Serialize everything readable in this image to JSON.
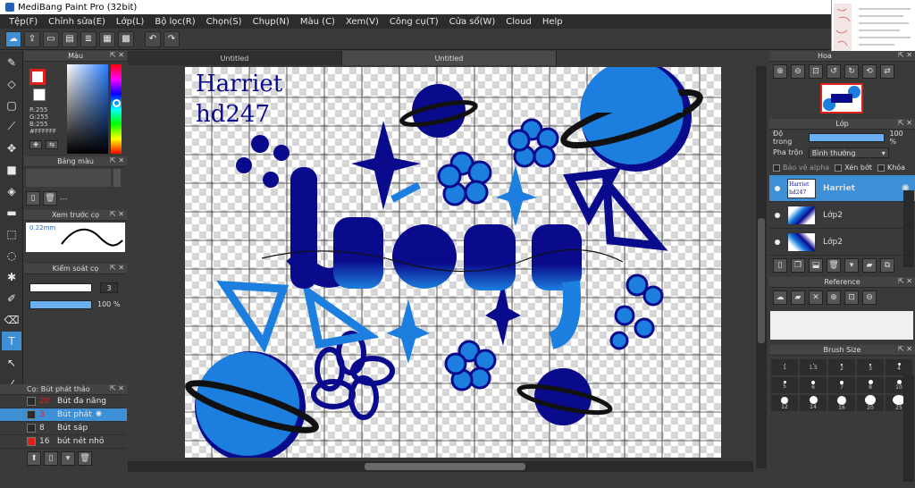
{
  "window": {
    "title": "MediBang Paint Pro (32bit)"
  },
  "menu": [
    "Tệp(F)",
    "Chỉnh sửa(E)",
    "Lớp(L)",
    "Bộ lọc(R)",
    "Chọn(S)",
    "Chụp(N)",
    "Màu (C)",
    "Xem(V)",
    "Công cụ(T)",
    "Cửa sổ(W)",
    "Cloud",
    "Help"
  ],
  "tabs": [
    "Untitled",
    "Untitled"
  ],
  "color_panel": {
    "title": "Màu",
    "r": "R:255",
    "g": "G:255",
    "b": "B:255",
    "hex": "#FFFFFF"
  },
  "palette_panel": {
    "title": "Bảng màu",
    "empty": "---"
  },
  "preview_panel": {
    "title": "Xem trước cọ",
    "size": "0.22mm"
  },
  "brush_control": {
    "title": "Kiểm soát cọ",
    "size_value": "3",
    "opacity_value": "100 %"
  },
  "brush_list": {
    "title": "Cọ: Bút phát thảo",
    "items": [
      {
        "num": "20",
        "name": "Bút đa năng"
      },
      {
        "num": "3",
        "name": "Bút phát"
      },
      {
        "num": "8",
        "name": "Bút sáp"
      },
      {
        "num": "16",
        "name": "bút nét nhỏ"
      }
    ]
  },
  "canvas": {
    "text_line1": "Harriet",
    "text_line2": "hd247"
  },
  "navigator": {
    "title": "Hoa"
  },
  "layer_panel": {
    "title": "Lớp",
    "opacity_label": "Độ trong",
    "opacity_value": "100 %",
    "blend_label": "Pha trộn",
    "blend_value": "Bình thường",
    "protect_alpha": "Bảo vệ alpha",
    "clipping": "Xén bớt",
    "lock": "Khóa",
    "layers": [
      "Harriet",
      "Lớp2",
      "Lớp2"
    ]
  },
  "reference_panel": {
    "title": "Reference"
  },
  "brush_size_panel": {
    "title": "Brush Size",
    "sizes": [
      "1",
      "1.5",
      "2",
      "3",
      "4",
      "5",
      "6",
      "7",
      "8",
      "10",
      "12",
      "14",
      "16",
      "20",
      "25"
    ]
  },
  "colors": {
    "accent": "#3d8fd6",
    "dark_blue": "#0a0a8c",
    "mid_blue": "#1464c8",
    "light_blue": "#2d8fe0",
    "red": "#e0201b"
  }
}
